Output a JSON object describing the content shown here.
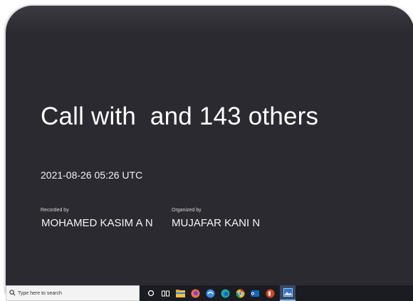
{
  "call": {
    "title": "Call with  and 143 others",
    "datetime": "2021-08-26 05:26 UTC",
    "recorded_by_label": "Recorded by",
    "recorded_by_name": "MOHAMED KASIM A N",
    "organized_by_label": "Organized by",
    "organized_by_name": "MUJAFAR KANI N"
  },
  "taskbar": {
    "search_placeholder": "Type here to search",
    "icons": [
      "search-icon",
      "cortana-icon",
      "task-view-icon",
      "file-explorer-icon",
      "firefox-icon",
      "edge-legacy-icon",
      "edge-icon",
      "chrome-icon",
      "outlook-icon",
      "powerpoint-icon",
      "photos-icon"
    ]
  },
  "colors": {
    "card_background": "#2b2a30",
    "taskbar_background": "#1a1c22",
    "text": "#ffffff"
  }
}
